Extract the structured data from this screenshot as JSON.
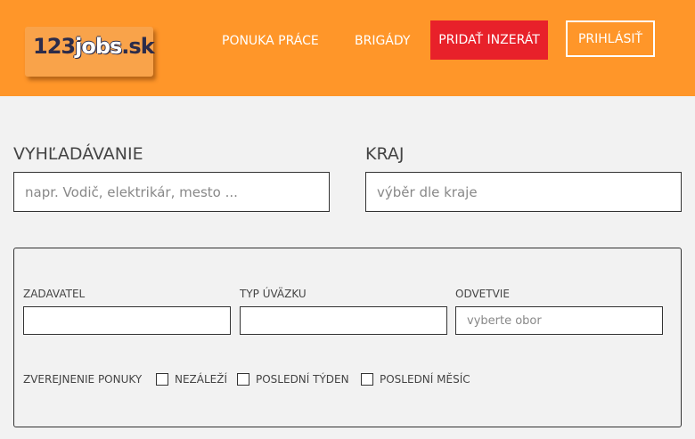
{
  "header": {
    "logo": {
      "num": "123",
      "word": "jobs",
      "tld": ".sk"
    },
    "nav": {
      "offers": "PONUKA PRÁCE",
      "temp_jobs": "BRIGÁDY",
      "add_listing": "PRIDAŤ INZERÁT",
      "login": "PRIHLÁSIŤ"
    },
    "colors": {
      "background": "#ff9629",
      "add_button": "#e8212a"
    }
  },
  "search": {
    "label": "VYHĽADÁVANIE",
    "placeholder": "napr. Vodič, elektrikár, mesto ..."
  },
  "region": {
    "label": "KRAJ",
    "placeholder": "výběr dle kraje"
  },
  "filters": {
    "employer": {
      "label": "ZADAVATEL",
      "value": ""
    },
    "employment_type": {
      "label": "TYP ÚVÄZKU",
      "value": ""
    },
    "industry": {
      "label": "ODVETVIE",
      "placeholder": "vyberte obor"
    },
    "publication": {
      "label": "ZVEREJNENIE PONUKY",
      "options": [
        {
          "label": "NEZÁLEŽÍ",
          "checked": false
        },
        {
          "label": "POSLEDNÍ TÝDEN",
          "checked": false
        },
        {
          "label": "POSLEDNÍ MĚSÍC",
          "checked": false
        }
      ]
    }
  }
}
